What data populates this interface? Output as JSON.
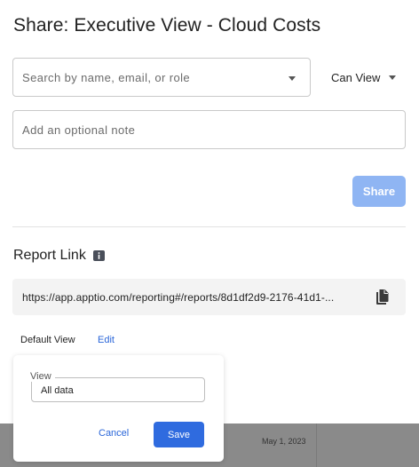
{
  "dialog": {
    "title": "Share: Executive View - Cloud Costs"
  },
  "share_form": {
    "search_placeholder": "Search by name, email, or role",
    "permission_value": "Can View",
    "note_placeholder": "Add an optional note",
    "share_label": "Share"
  },
  "report_link": {
    "section_title": "Report Link",
    "url_display": "https://app.apptio.com/reporting#/reports/8d1df2d9-2176-41d1-...",
    "default_view_label": "Default View",
    "edit_label": "Edit"
  },
  "default_view_popover": {
    "field_label": "View",
    "field_value": "All data",
    "cancel_label": "Cancel",
    "save_label": "Save"
  },
  "background_table": {
    "date_cell": "May 1, 2023"
  },
  "colors": {
    "primary": "#2f6bdf",
    "primary_disabled": "#8fb5f3",
    "link": "#2a66d9"
  },
  "icons": {
    "dropdown": "caret-down-icon",
    "info": "info-icon",
    "copy": "copy-icon"
  }
}
